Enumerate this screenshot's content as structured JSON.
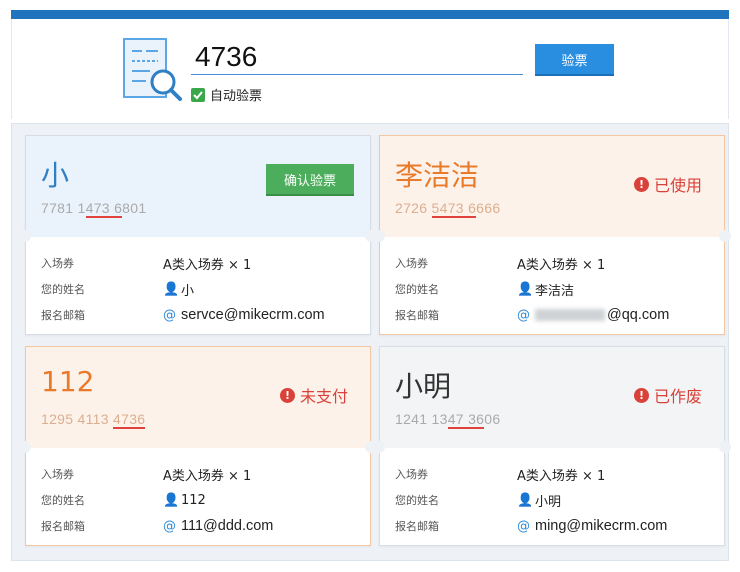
{
  "search": {
    "value": "4736",
    "button": "验票",
    "auto_verify_label": "自动验票",
    "auto_verify_checked": true
  },
  "labels": {
    "ticket": "入场券",
    "name": "您的姓名",
    "email": "报名邮箱"
  },
  "colors": {
    "primary": "#2a8ee0",
    "success": "#4cae5c",
    "danger": "#d9423a",
    "accent_orange": "#e97a2a"
  },
  "cards": [
    {
      "name": "小",
      "code_pre": "7781 1",
      "code_hl": "473 6",
      "code_post": "801",
      "action": "确认验票",
      "ticket": "A类入场券 × 1",
      "person": "小",
      "email": "servce@mikecrm.com",
      "email_masked": false
    },
    {
      "name": "李洁洁",
      "code_pre": "2726 ",
      "code_hl": "5473 6",
      "code_post": "666",
      "status": "已使用",
      "ticket": "A类入场券 × 1",
      "person": "李洁洁",
      "email": "@qq.com",
      "email_masked": true
    },
    {
      "name": "112",
      "code_pre": "1295 4113 ",
      "code_hl": "4736",
      "code_post": "",
      "status": "未支付",
      "ticket": "A类入场券 × 1",
      "person": "112",
      "email": "111@ddd.com",
      "email_masked": false
    },
    {
      "name": "小明",
      "code_pre": "1241 13",
      "code_hl": "47 36",
      "code_post": "06",
      "status": "已作废",
      "ticket": "A类入场券 × 1",
      "person": "小明",
      "email": "ming@mikecrm.com",
      "email_masked": false
    }
  ]
}
